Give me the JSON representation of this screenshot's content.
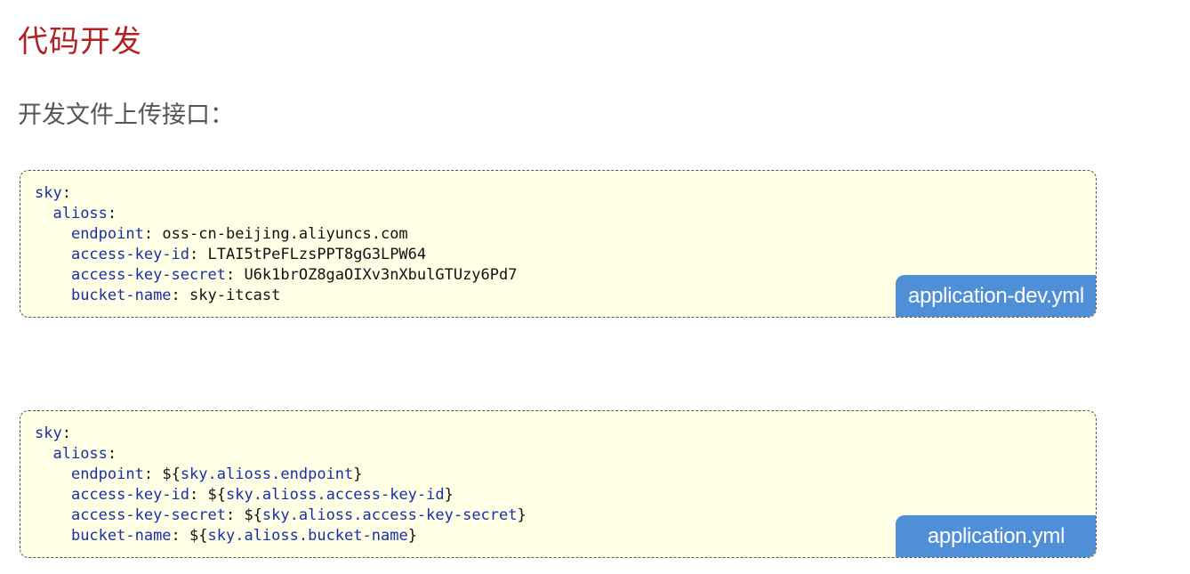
{
  "heading": "代码开发",
  "subheading": "开发文件上传接口：",
  "blocks": [
    {
      "filename": "application-dev.yml",
      "lines": [
        {
          "indent": "",
          "key": "sky",
          "colon": ":",
          "value": ""
        },
        {
          "indent": "  ",
          "key": "alioss",
          "colon": ":",
          "value": ""
        },
        {
          "indent": "    ",
          "key": "endpoint",
          "colon": ": ",
          "value": "oss-cn-beijing.aliyuncs.com"
        },
        {
          "indent": "    ",
          "key": "access-key-id",
          "colon": ": ",
          "value": "LTAI5tPeFLzsPPT8gG3LPW64"
        },
        {
          "indent": "    ",
          "key": "access-key-secret",
          "colon": ": ",
          "value": "U6k1brOZ8gaOIXv3nXbulGTUzy6Pd7"
        },
        {
          "indent": "    ",
          "key": "bucket-name",
          "colon": ": ",
          "value": "sky-itcast"
        }
      ]
    },
    {
      "filename": "application.yml",
      "lines": [
        {
          "indent": "",
          "key": "sky",
          "colon": ":",
          "pre": "",
          "ref": "",
          "post": ""
        },
        {
          "indent": "  ",
          "key": "alioss",
          "colon": ":",
          "pre": "",
          "ref": "",
          "post": ""
        },
        {
          "indent": "    ",
          "key": "endpoint",
          "colon": ": ",
          "pre": "${",
          "ref": "sky.alioss.endpoint",
          "post": "}"
        },
        {
          "indent": "    ",
          "key": "access-key-id",
          "colon": ": ",
          "pre": "${",
          "ref": "sky.alioss.access-key-id",
          "post": "}"
        },
        {
          "indent": "    ",
          "key": "access-key-secret",
          "colon": ": ",
          "pre": "${",
          "ref": "sky.alioss.access-key-secret",
          "post": "}"
        },
        {
          "indent": "    ",
          "key": "bucket-name",
          "colon": ": ",
          "pre": "${",
          "ref": "sky.alioss.bucket-name",
          "post": "}"
        }
      ]
    }
  ],
  "colors": {
    "heading": "#b22222",
    "subheading": "#555555",
    "code_background": "#ffffe6",
    "yaml_key": "#1a2fa8",
    "file_tag_background": "#4f8fd8"
  }
}
